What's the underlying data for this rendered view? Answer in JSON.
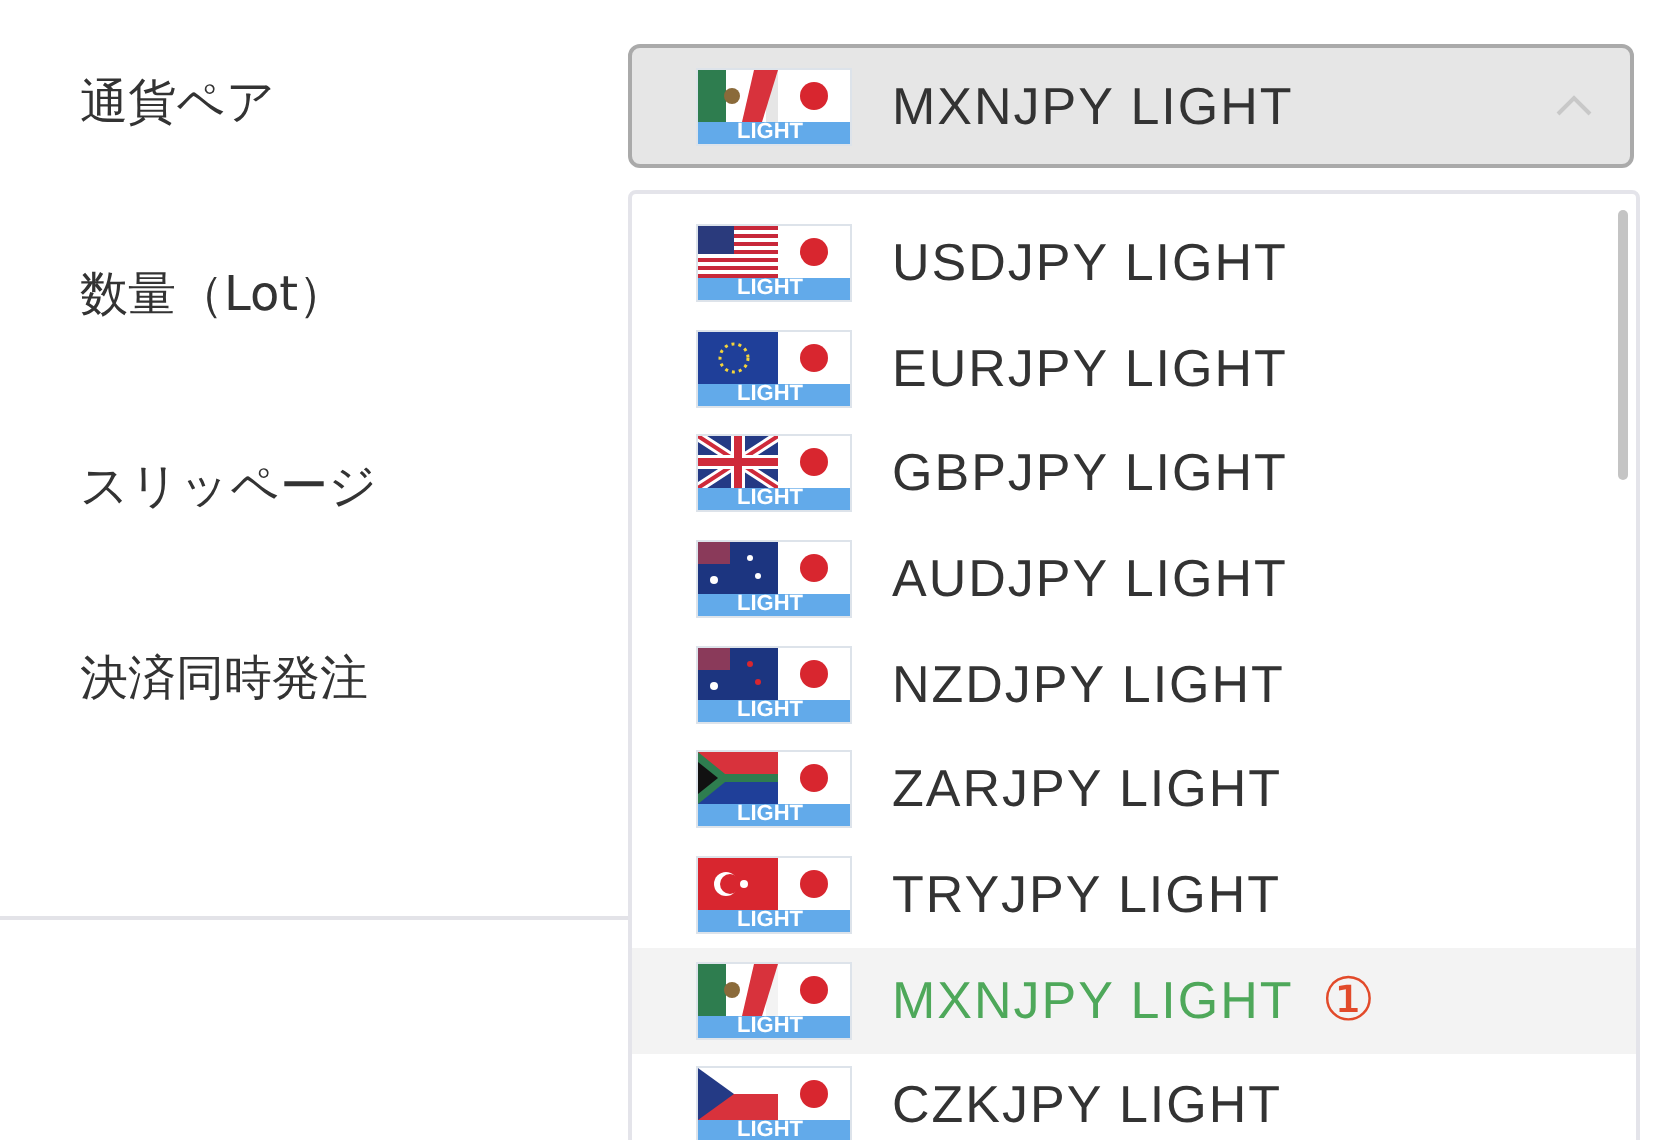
{
  "form": {
    "labels": [
      "通貨ペア",
      "数量（Lot）",
      "スリッページ",
      "決済同時発注"
    ]
  },
  "select": {
    "kind": "mx",
    "badge": "LIGHT",
    "value": "MXNJPY LIGHT",
    "expanded": true
  },
  "options": [
    {
      "kind": "us",
      "badge": "LIGHT",
      "label": "USDJPY LIGHT",
      "selected": false
    },
    {
      "kind": "eu",
      "badge": "LIGHT",
      "label": "EURJPY LIGHT",
      "selected": false
    },
    {
      "kind": "gb",
      "badge": "LIGHT",
      "label": "GBPJPY LIGHT",
      "selected": false
    },
    {
      "kind": "au",
      "badge": "LIGHT",
      "label": "AUDJPY LIGHT",
      "selected": false
    },
    {
      "kind": "nz",
      "badge": "LIGHT",
      "label": "NZDJPY LIGHT",
      "selected": false
    },
    {
      "kind": "za",
      "badge": "LIGHT",
      "label": "ZARJPY LIGHT",
      "selected": false
    },
    {
      "kind": "tr",
      "badge": "LIGHT",
      "label": "TRYJPY LIGHT",
      "selected": false
    },
    {
      "kind": "mx",
      "badge": "LIGHT",
      "label": "MXNJPY LIGHT",
      "selected": true,
      "note": "①"
    },
    {
      "kind": "cz",
      "badge": "LIGHT",
      "label": "CZKJPY LIGHT",
      "selected": false
    }
  ]
}
